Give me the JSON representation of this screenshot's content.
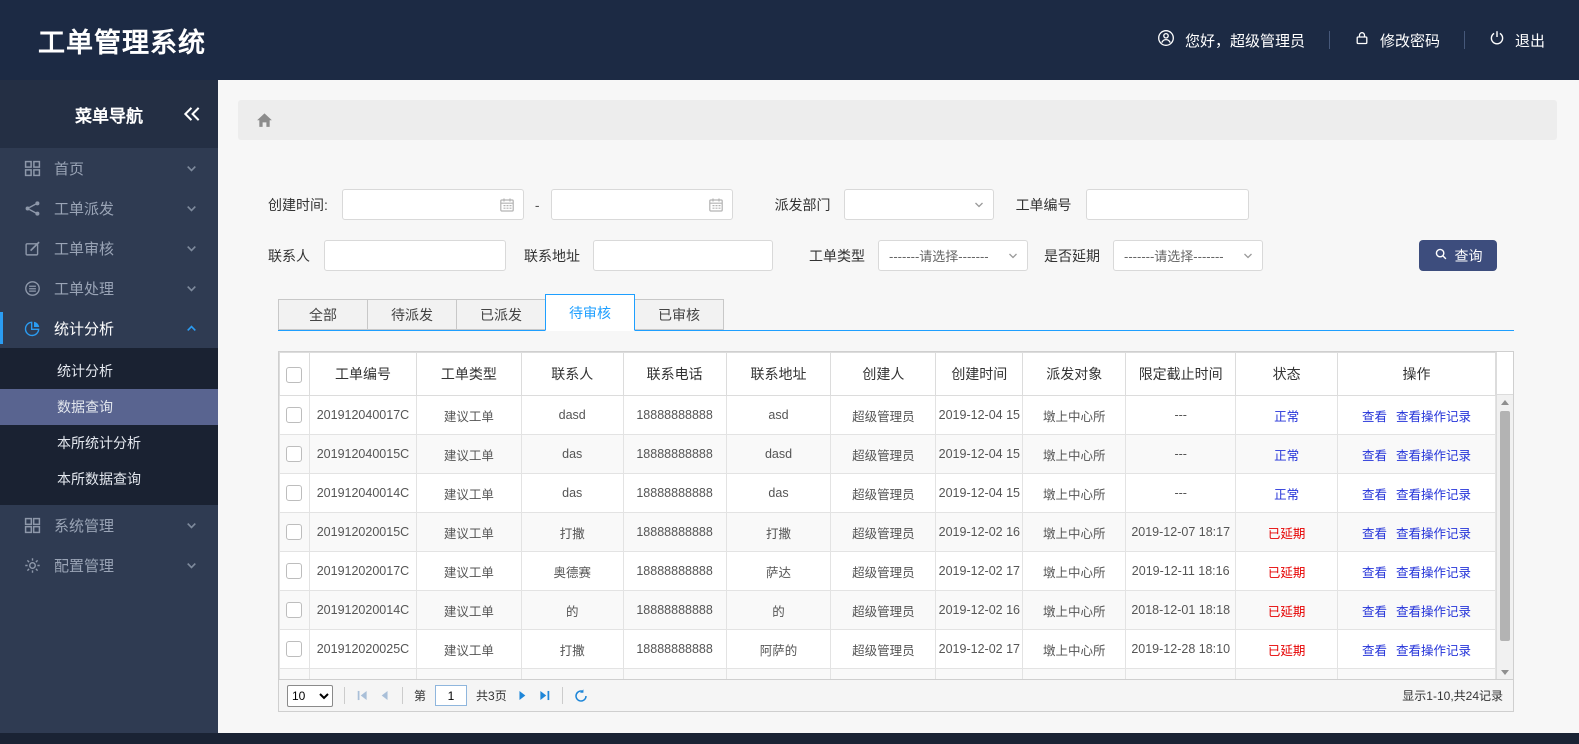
{
  "app": {
    "title": "工单管理系统"
  },
  "topbar": {
    "greeting": "您好，超级管理员",
    "change_password": "修改密码",
    "logout": "退出",
    "icons": [
      "user-circle-icon",
      "lock-icon",
      "power-icon"
    ]
  },
  "sidebar": {
    "title": "菜单导航",
    "collapse_icon": "double-chevron-left-icon",
    "items": [
      {
        "id": "home",
        "label": "首页",
        "icon": "grid-icon",
        "active": false,
        "expanded": false
      },
      {
        "id": "dispatch",
        "label": "工单派发",
        "icon": "share-icon",
        "active": false,
        "expanded": false
      },
      {
        "id": "review",
        "label": "工单审核",
        "icon": "edit-icon",
        "active": false,
        "expanded": false
      },
      {
        "id": "process",
        "label": "工单处理",
        "icon": "database-icon",
        "active": false,
        "expanded": false
      },
      {
        "id": "statistics",
        "label": "统计分析",
        "icon": "pie-chart-icon",
        "active": true,
        "expanded": true
      },
      {
        "id": "system",
        "label": "系统管理",
        "icon": "apps-icon",
        "active": false,
        "expanded": false
      },
      {
        "id": "config",
        "label": "配置管理",
        "icon": "gear-icon",
        "active": false,
        "expanded": false
      }
    ],
    "submenu": [
      {
        "id": "stats-analysis",
        "label": "统计分析",
        "active": false
      },
      {
        "id": "data-query",
        "label": "数据查询",
        "active": true
      },
      {
        "id": "branch-stats",
        "label": "本所统计分析",
        "active": false
      },
      {
        "id": "branch-data-query",
        "label": "本所数据查询",
        "active": false
      }
    ]
  },
  "breadcrumb": {
    "home_icon": "home-icon"
  },
  "filters": {
    "created_time_label": "创建时间:",
    "created_start_value": "",
    "created_end_value": "",
    "range_separator": "-",
    "dispatch_dept_label": "派发部门",
    "dispatch_dept_value": "",
    "order_no_label": "工单编号",
    "order_no_value": "",
    "contact_label": "联系人",
    "contact_value": "",
    "address_label": "联系地址",
    "address_value": "",
    "order_type_label": "工单类型",
    "order_type_placeholder": "-------请选择-------",
    "delay_label": "是否延期",
    "delay_placeholder": "-------请选择-------",
    "search_button": "查询"
  },
  "tabs": [
    {
      "id": "all",
      "label": "全部",
      "active": false
    },
    {
      "id": "pending-dispatch",
      "label": "待派发",
      "active": false
    },
    {
      "id": "dispatched",
      "label": "已派发",
      "active": false
    },
    {
      "id": "pending-review",
      "label": "待审核",
      "active": true
    },
    {
      "id": "reviewed",
      "label": "已审核",
      "active": false
    }
  ],
  "table": {
    "columns": [
      "工单编号",
      "工单类型",
      "联系人",
      "联系电话",
      "联系地址",
      "创建人",
      "创建时间",
      "派发对象",
      "限定截止时间",
      "状态",
      "操作"
    ],
    "action_labels": {
      "view": "查看",
      "view_log": "查看操作记录"
    },
    "rows": [
      {
        "no": "201912040017C",
        "type": "建议工单",
        "contact": "dasd",
        "phone": "18888888888",
        "address": "asd",
        "creator": "超级管理员",
        "created": "2019-12-04 15",
        "target": "墩上中心所",
        "deadline": "---",
        "status": "正常",
        "status_type": "normal"
      },
      {
        "no": "201912040015C",
        "type": "建议工单",
        "contact": "das",
        "phone": "18888888888",
        "address": "dasd",
        "creator": "超级管理员",
        "created": "2019-12-04 15",
        "target": "墩上中心所",
        "deadline": "---",
        "status": "正常",
        "status_type": "normal"
      },
      {
        "no": "201912040014C",
        "type": "建议工单",
        "contact": "das",
        "phone": "18888888888",
        "address": "das",
        "creator": "超级管理员",
        "created": "2019-12-04 15",
        "target": "墩上中心所",
        "deadline": "---",
        "status": "正常",
        "status_type": "normal"
      },
      {
        "no": "201912020015C",
        "type": "建议工单",
        "contact": "打撒",
        "phone": "18888888888",
        "address": "打撒",
        "creator": "超级管理员",
        "created": "2019-12-02 16",
        "target": "墩上中心所",
        "deadline": "2019-12-07 18:17",
        "status": "已延期",
        "status_type": "delayed"
      },
      {
        "no": "201912020017C",
        "type": "建议工单",
        "contact": "奥德赛",
        "phone": "18888888888",
        "address": "萨达",
        "creator": "超级管理员",
        "created": "2019-12-02 17",
        "target": "墩上中心所",
        "deadline": "2019-12-11 18:16",
        "status": "已延期",
        "status_type": "delayed"
      },
      {
        "no": "201912020014C",
        "type": "建议工单",
        "contact": "的",
        "phone": "18888888888",
        "address": "的",
        "creator": "超级管理员",
        "created": "2019-12-02 16",
        "target": "墩上中心所",
        "deadline": "2018-12-01 18:18",
        "status": "已延期",
        "status_type": "delayed"
      },
      {
        "no": "201912020025C",
        "type": "建议工单",
        "contact": "打撒",
        "phone": "18888888888",
        "address": "阿萨的",
        "creator": "超级管理员",
        "created": "2019-12-02 17",
        "target": "墩上中心所",
        "deadline": "2019-12-28 18:10",
        "status": "已延期",
        "status_type": "delayed"
      },
      {
        "no": "",
        "type": "",
        "contact": "",
        "phone": "",
        "address": "",
        "creator": "",
        "created": "",
        "target": "",
        "deadline": "",
        "status": "",
        "status_type": ""
      }
    ]
  },
  "pager": {
    "page_size": "10",
    "page_size_options": [
      "10"
    ],
    "page_prefix": "第",
    "current_page": "1",
    "total_pages_label": "共3页",
    "summary": "显示1-10,共24记录"
  },
  "colors": {
    "header_bg": "#1c2a44",
    "footer_bg": "#1a2334",
    "sidebar_bg": "#2f3b52",
    "sidebar_head_bg": "#242f44",
    "submenu_bg": "#1a2232",
    "submenu_active_bg": "#596490",
    "accent_blue": "#1e9fff",
    "menu_active_blue": "#2b9cf2",
    "search_button_bg": "#3d4d7d",
    "status_normal": "#2433d9",
    "status_delayed": "#e60000",
    "link_blue": "#2433d9",
    "pager_icon_blue": "#1e86d8",
    "pager_icon_disabled": "#a9bfd8"
  }
}
